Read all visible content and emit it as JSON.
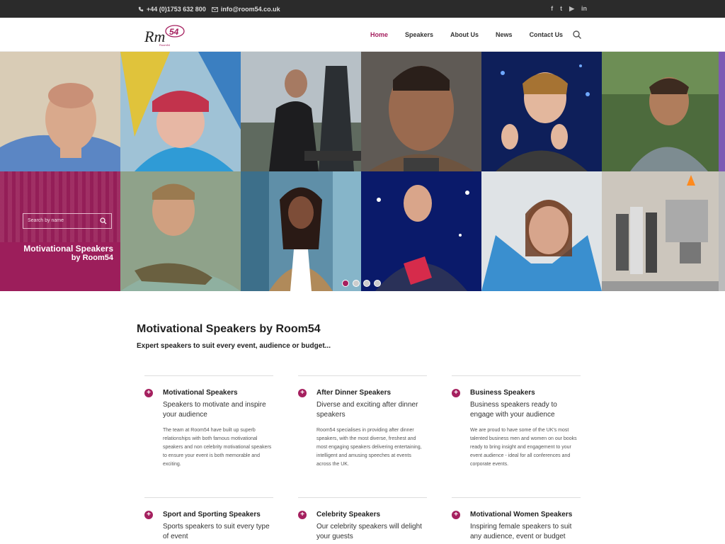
{
  "topbar": {
    "phone": "+44 (0)1753 632 800",
    "email": "info@room54.co.uk",
    "social": [
      "f",
      "t",
      "▶",
      "in"
    ]
  },
  "header": {
    "logo_text": "Rm",
    "logo_badge": "54",
    "logo_sub": "Room54",
    "nav": [
      {
        "label": "Home",
        "active": true
      },
      {
        "label": "Speakers",
        "active": false
      },
      {
        "label": "About Us",
        "active": false
      },
      {
        "label": "News",
        "active": false
      },
      {
        "label": "Contact Us",
        "active": false
      }
    ]
  },
  "hero": {
    "promo_title": "Motivational Speakers",
    "promo_sub": "by Room54",
    "search_placeholder": "Search by name",
    "slides": 4,
    "active_slide": 0
  },
  "main": {
    "heading": "Motivational Speakers by Room54",
    "tagline": "Expert speakers to suit every event, audience or budget...",
    "cards": [
      {
        "title": "Motivational Speakers",
        "sub": "Speakers to motivate and inspire your audience",
        "body": "The team at Room54 have built up superb relationships with both famous motivational speakers and non celebrity motivational speakers to ensure your event is both memorable and exciting."
      },
      {
        "title": "After Dinner Speakers",
        "sub": "Diverse and exciting after dinner speakers",
        "body": "Room54 specialises in providing after dinner speakers, with the most diverse, freshest and most engaging speakers delivering entertaining, intelligent and amusing speeches at events across the UK."
      },
      {
        "title": "Business Speakers",
        "sub": "Business speakers ready to engage with your audience",
        "body": "We are proud to have some of the UK's most talented business men and women on our books ready to bring insight and engagement to your event audience - ideal for all conferences and corporate events."
      },
      {
        "title": "Sport and Sporting Speakers",
        "sub": "Sports speakers to suit every type of event",
        "body": ""
      },
      {
        "title": "Celebrity Speakers",
        "sub": "Our celebrity speakers will delight your guests",
        "body": ""
      },
      {
        "title": "Motivational Women Speakers",
        "sub": "Inspiring female speakers to suit any audience, event or budget",
        "body": ""
      }
    ]
  },
  "colors": {
    "brand": "#a5205f",
    "topbar": "#2b2b2b"
  }
}
